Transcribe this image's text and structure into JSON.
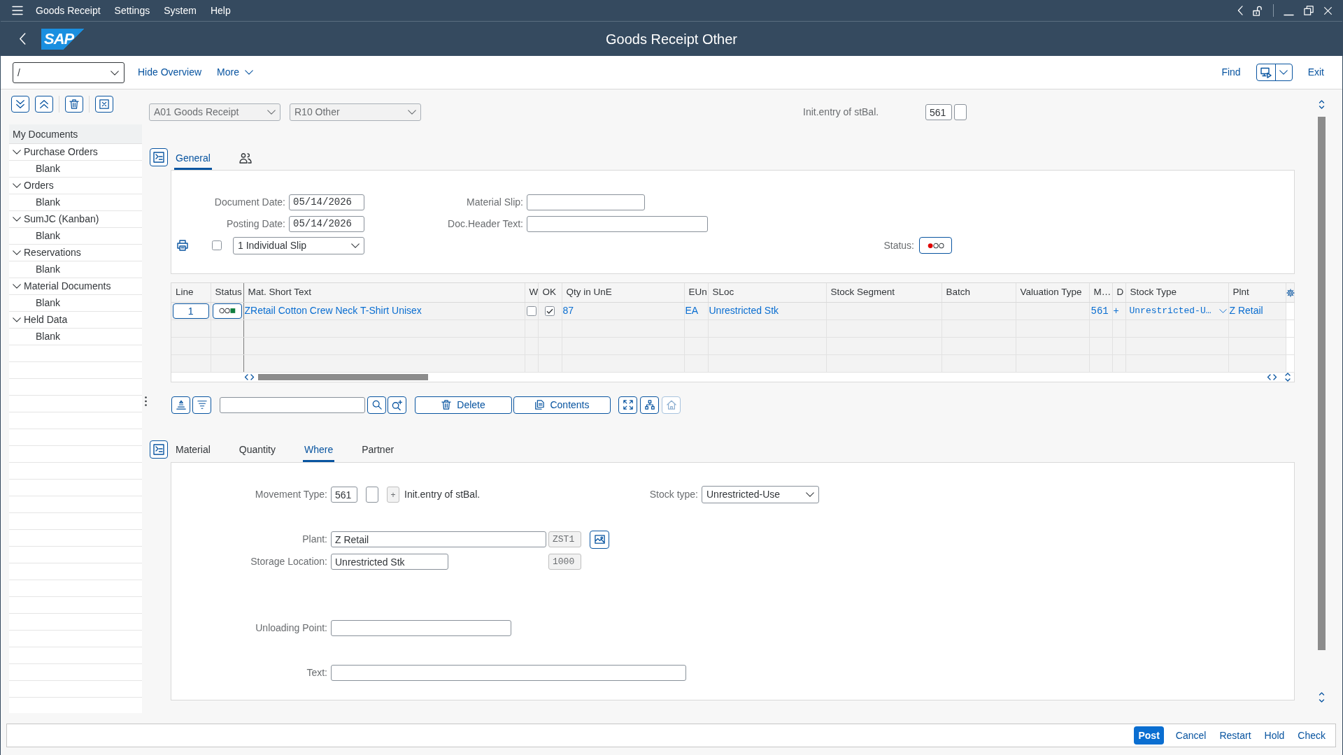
{
  "menu_bar": {
    "items": [
      {
        "label": "Goods Receipt"
      },
      {
        "label": "Settings"
      },
      {
        "label": "System"
      },
      {
        "label": "Help"
      }
    ]
  },
  "title_bar": {
    "logo": "SAP",
    "title": "Goods Receipt Other"
  },
  "toolbar": {
    "command_field": {
      "value": "/"
    },
    "left": [
      {
        "kind": "link",
        "label": "Hide Overview"
      },
      {
        "kind": "menu",
        "label": "More"
      }
    ],
    "right": [
      {
        "kind": "link",
        "label": "Find"
      },
      {
        "kind": "split"
      },
      {
        "kind": "link",
        "label": "Exit"
      }
    ]
  },
  "sidebar": {
    "title": "My Documents",
    "items": [
      {
        "label": "Purchase Orders",
        "expanded": true,
        "children": [
          {
            "label": "Blank"
          }
        ]
      },
      {
        "label": "Orders",
        "expanded": true,
        "children": [
          {
            "label": "Blank"
          }
        ]
      },
      {
        "label": "SumJC (Kanban)",
        "expanded": true,
        "children": [
          {
            "label": "Blank"
          }
        ]
      },
      {
        "label": "Reservations",
        "expanded": true,
        "children": [
          {
            "label": "Blank"
          }
        ]
      },
      {
        "label": "Material Documents",
        "expanded": true,
        "children": [
          {
            "label": "Blank"
          }
        ]
      },
      {
        "label": "Held Data",
        "expanded": true,
        "children": [
          {
            "label": "Blank"
          }
        ]
      }
    ]
  },
  "header": {
    "transaction": {
      "value": "A01 Goods Receipt"
    },
    "reference": {
      "value": "R10 Other"
    },
    "movement": {
      "label": "Init.entry of stBal.",
      "value": "561"
    }
  },
  "header_tabs": [
    {
      "kind": "text",
      "label": "General",
      "selected": true
    },
    {
      "kind": "icon",
      "selected": false
    }
  ],
  "general": {
    "document_date": {
      "label": "Document Date:",
      "value": "05/14/2026"
    },
    "posting_date": {
      "label": "Posting Date:",
      "value": "05/14/2026"
    },
    "material_slip": {
      "label": "Material Slip:"
    },
    "doc_header_text": {
      "label": "Doc.Header Text:"
    },
    "print": {
      "checked": false,
      "version": "1 Individual Slip"
    },
    "status": {
      "label": "Status:",
      "red": true,
      "yellow": false,
      "green": false
    }
  },
  "items_table": {
    "columns": [
      "Line",
      "Status",
      "Mat. Short Text",
      "W",
      "OK",
      "Qty in UnE",
      "EUn",
      "SLoc",
      "Stock Segment",
      "Batch",
      "Valuation Type",
      "M…",
      "D",
      "Stock Type",
      "Plnt"
    ],
    "rows": [
      {
        "cells": [
          {
            "kind": "field",
            "text": "1"
          },
          {
            "kind": "status",
            "red": false,
            "yellow": false,
            "green": true
          },
          {
            "kind": "link",
            "text": "ZRetail Cotton Crew Neck T-Shirt Unisex"
          },
          {
            "kind": "checkbox",
            "checked": false
          },
          {
            "kind": "checkbox",
            "checked": true
          },
          {
            "kind": "link",
            "text": "87"
          },
          {
            "kind": "link",
            "text": "EA"
          },
          {
            "kind": "link",
            "text": "Unrestricted Stk"
          },
          {
            "kind": "empty"
          },
          {
            "kind": "empty"
          },
          {
            "kind": "empty"
          },
          {
            "kind": "code",
            "text": "561"
          },
          {
            "kind": "link",
            "text": "+"
          },
          {
            "kind": "select",
            "text": "Unrestricted-U…"
          },
          {
            "kind": "link",
            "text": "Z Retail"
          }
        ]
      }
    ]
  },
  "table_toolbar": {
    "buttons": [
      {
        "label": "Delete"
      },
      {
        "label": "Contents"
      }
    ],
    "nav_buttons": [
      {
        "disabled": false
      },
      {
        "disabled": false
      },
      {
        "disabled": true
      }
    ]
  },
  "detail_tabs": [
    {
      "label": "Material",
      "selected": false
    },
    {
      "label": "Quantity",
      "selected": false
    },
    {
      "label": "Where",
      "selected": true
    },
    {
      "label": "Partner",
      "selected": false
    }
  ],
  "where": {
    "movement_type": {
      "label": "Movement Type:",
      "value": "561",
      "indicator": "+",
      "description": "Init.entry of stBal."
    },
    "stock_type": {
      "label": "Stock type:",
      "value": "Unrestricted-Use"
    },
    "plant": {
      "label": "Plant:",
      "value": "Z Retail",
      "code": "ZST1"
    },
    "storage_location": {
      "label": "Storage Location:",
      "value": "Unrestricted Stk",
      "code": "1000"
    },
    "unloading_point": {
      "label": "Unloading Point:"
    },
    "text": {
      "label": "Text:"
    }
  },
  "footer": {
    "buttons": [
      {
        "kind": "primary",
        "label": "Post"
      },
      {
        "kind": "plain",
        "label": "Cancel"
      },
      {
        "kind": "plain",
        "label": "Restart"
      },
      {
        "kind": "plain",
        "label": "Hold"
      },
      {
        "kind": "plain",
        "label": "Check"
      }
    ]
  }
}
